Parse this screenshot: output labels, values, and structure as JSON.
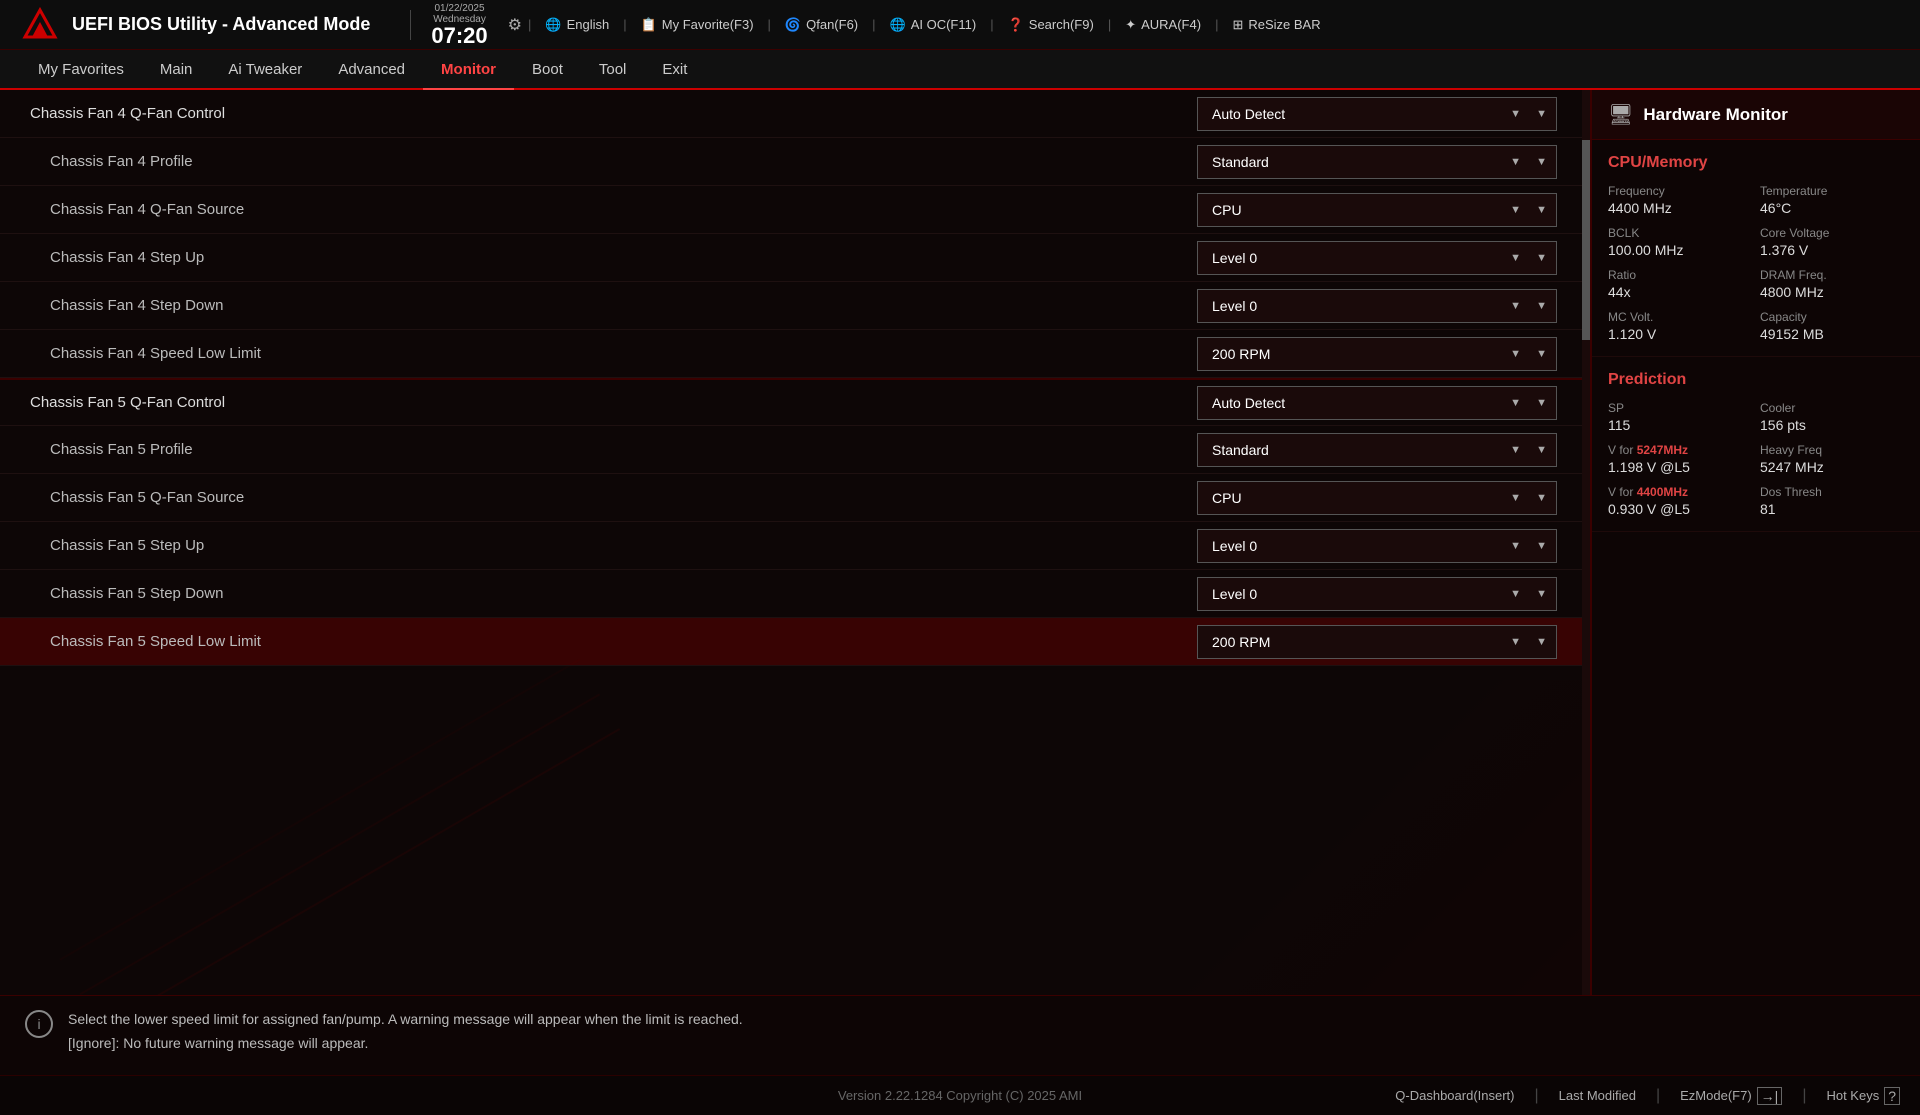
{
  "header": {
    "title": "UEFI BIOS Utility - Advanced Mode",
    "date": "01/22/2025\nWednesday",
    "date_line1": "01/22/2025",
    "date_line2": "Wednesday",
    "time": "07:20",
    "tools": [
      {
        "id": "settings",
        "icon": "⚙",
        "label": ""
      },
      {
        "id": "english",
        "icon": "🌐",
        "label": "English"
      },
      {
        "id": "myfav",
        "icon": "📋",
        "label": "My Favorite(F3)"
      },
      {
        "id": "qfan",
        "icon": "🌀",
        "label": "Qfan(F6)"
      },
      {
        "id": "aioc",
        "icon": "🌐",
        "label": "AI OC(F11)"
      },
      {
        "id": "search",
        "icon": "❓",
        "label": "Search(F9)"
      },
      {
        "id": "aura",
        "icon": "✦",
        "label": "AURA(F4)"
      },
      {
        "id": "resize",
        "icon": "⊞",
        "label": "ReSize BAR"
      }
    ]
  },
  "navbar": {
    "items": [
      {
        "id": "myfavorites",
        "label": "My Favorites"
      },
      {
        "id": "main",
        "label": "Main"
      },
      {
        "id": "aitweaker",
        "label": "Ai Tweaker"
      },
      {
        "id": "advanced",
        "label": "Advanced"
      },
      {
        "id": "monitor",
        "label": "Monitor",
        "active": true
      },
      {
        "id": "boot",
        "label": "Boot"
      },
      {
        "id": "tool",
        "label": "Tool"
      },
      {
        "id": "exit",
        "label": "Exit"
      }
    ]
  },
  "settings": {
    "rows": [
      {
        "id": "chassis4-control",
        "label": "Chassis Fan 4 Q-Fan Control",
        "value": "Auto Detect",
        "indent": false,
        "active": false,
        "section_start": false
      },
      {
        "id": "chassis4-profile",
        "label": "Chassis Fan 4 Profile",
        "value": "Standard",
        "indent": true,
        "active": false,
        "section_start": false
      },
      {
        "id": "chassis4-source",
        "label": "Chassis Fan 4 Q-Fan Source",
        "value": "CPU",
        "indent": true,
        "active": false,
        "section_start": false
      },
      {
        "id": "chassis4-stepup",
        "label": "Chassis Fan 4 Step Up",
        "value": "Level 0",
        "indent": true,
        "active": false,
        "section_start": false
      },
      {
        "id": "chassis4-stepdown",
        "label": "Chassis Fan 4 Step Down",
        "value": "Level 0",
        "indent": true,
        "active": false,
        "section_start": false
      },
      {
        "id": "chassis4-speedlimit",
        "label": "Chassis Fan 4 Speed Low Limit",
        "value": "200 RPM",
        "indent": true,
        "active": false,
        "section_start": false
      },
      {
        "id": "chassis5-control",
        "label": "Chassis Fan 5 Q-Fan Control",
        "value": "Auto Detect",
        "indent": false,
        "active": false,
        "section_start": true
      },
      {
        "id": "chassis5-profile",
        "label": "Chassis Fan 5 Profile",
        "value": "Standard",
        "indent": true,
        "active": false,
        "section_start": false
      },
      {
        "id": "chassis5-source",
        "label": "Chassis Fan 5 Q-Fan Source",
        "value": "CPU",
        "indent": true,
        "active": false,
        "section_start": false
      },
      {
        "id": "chassis5-stepup",
        "label": "Chassis Fan 5 Step Up",
        "value": "Level 0",
        "indent": true,
        "active": false,
        "section_start": false
      },
      {
        "id": "chassis5-stepdown",
        "label": "Chassis Fan 5 Step Down",
        "value": "Level 0",
        "indent": true,
        "active": false,
        "section_start": false
      },
      {
        "id": "chassis5-speedlimit",
        "label": "Chassis Fan 5 Speed Low Limit",
        "value": "200 RPM",
        "indent": true,
        "active": true,
        "section_start": false
      }
    ]
  },
  "info_bar": {
    "line1": "Select the lower speed limit for assigned fan/pump. A warning message will appear when the limit is reached.",
    "line2": "[Ignore]: No future warning message will appear."
  },
  "footer": {
    "version": "Version 2.22.1284 Copyright (C) 2025 AMI",
    "buttons": [
      {
        "id": "qdashboard",
        "label": "Q-Dashboard(Insert)"
      },
      {
        "id": "lastmodified",
        "label": "Last Modified"
      },
      {
        "id": "ezmode",
        "label": "EzMode(F7)"
      },
      {
        "id": "hotkeys",
        "label": "Hot Keys"
      }
    ]
  },
  "hw_monitor": {
    "title": "Hardware Monitor",
    "sections": [
      {
        "id": "cpu-memory",
        "title": "CPU/Memory",
        "items": [
          {
            "id": "frequency",
            "label": "Frequency",
            "value": "4400 MHz"
          },
          {
            "id": "temperature",
            "label": "Temperature",
            "value": "46°C"
          },
          {
            "id": "bclk",
            "label": "BCLK",
            "value": "100.00 MHz"
          },
          {
            "id": "core-voltage",
            "label": "Core Voltage",
            "value": "1.376 V"
          },
          {
            "id": "ratio",
            "label": "Ratio",
            "value": "44x"
          },
          {
            "id": "dram-freq",
            "label": "DRAM Freq.",
            "value": "4800 MHz"
          },
          {
            "id": "mc-volt",
            "label": "MC Volt.",
            "value": "1.120 V"
          },
          {
            "id": "capacity",
            "label": "Capacity",
            "value": "49152 MB"
          }
        ]
      },
      {
        "id": "prediction",
        "title": "Prediction",
        "items": [
          {
            "id": "sp",
            "label": "SP",
            "value": "115"
          },
          {
            "id": "cooler",
            "label": "Cooler",
            "value": "156 pts"
          },
          {
            "id": "v-for-5247",
            "label": "V for 5247MHz",
            "value": "1.198 V @L5",
            "highlight_label": "5247MHz"
          },
          {
            "id": "heavy-freq",
            "label": "Heavy Freq",
            "value": "5247 MHz"
          },
          {
            "id": "v-for-4400",
            "label": "V for 4400MHz",
            "value": "0.930 V @L5",
            "highlight_label": "4400MHz"
          },
          {
            "id": "dos-thresh",
            "label": "Dos Thresh",
            "value": "81"
          }
        ]
      }
    ]
  }
}
